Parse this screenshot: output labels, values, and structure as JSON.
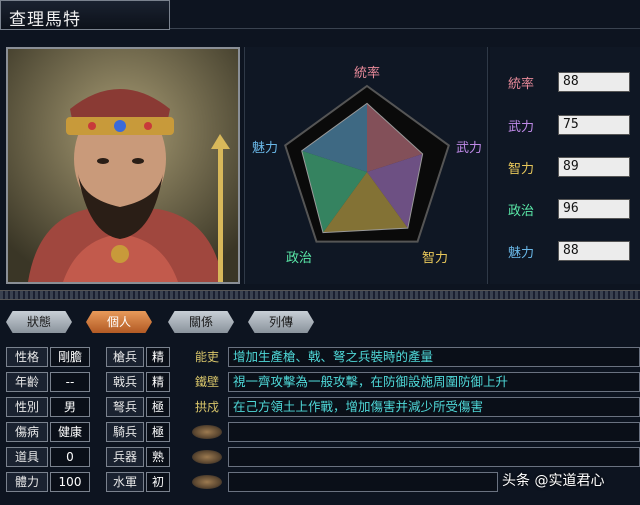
{
  "character": {
    "name": "查理馬特"
  },
  "radar": {
    "labels": [
      "統率",
      "武力",
      "智力",
      "政治",
      "魅力"
    ],
    "label_colors": [
      "#e88a9a",
      "#c08ae8",
      "#e8c85a",
      "#5ae8a8",
      "#6ab8e8"
    ],
    "values": [
      88,
      75,
      89,
      96,
      88
    ],
    "max": 100
  },
  "stats": [
    {
      "label": "統率",
      "value": "88",
      "color": "#e88a9a"
    },
    {
      "label": "武力",
      "value": "75",
      "color": "#c08ae8"
    },
    {
      "label": "智力",
      "value": "89",
      "color": "#e8c85a"
    },
    {
      "label": "政治",
      "value": "96",
      "color": "#5ae8a8"
    },
    {
      "label": "魅力",
      "value": "88",
      "color": "#6ab8e8"
    }
  ],
  "tabs": [
    "狀態",
    "個人",
    "關係",
    "列傳"
  ],
  "active_tab": "個人",
  "personal": [
    {
      "label": "性格",
      "value": "剛膽"
    },
    {
      "label": "年齡",
      "value": "--"
    },
    {
      "label": "性別",
      "value": "男"
    },
    {
      "label": "傷病",
      "value": "健康"
    },
    {
      "label": "道具",
      "value": "0"
    },
    {
      "label": "體力",
      "value": "100"
    }
  ],
  "troops": [
    {
      "label": "槍兵",
      "value": "精"
    },
    {
      "label": "戟兵",
      "value": "精"
    },
    {
      "label": "弩兵",
      "value": "極"
    },
    {
      "label": "騎兵",
      "value": "極"
    },
    {
      "label": "兵器",
      "value": "熟"
    },
    {
      "label": "水軍",
      "value": "初"
    }
  ],
  "skills": [
    {
      "name": "能吏",
      "desc": "增加生產槍、戟、弩之兵裝時的產量"
    },
    {
      "name": "鐵壁",
      "desc": "視一齊攻擊為一般攻擊，在防御設施周圍防御上升"
    },
    {
      "name": "拱戍",
      "desc": "在己方領土上作戰，增加傷害并減少所受傷害"
    },
    {
      "name": "",
      "desc": ""
    },
    {
      "name": "",
      "desc": ""
    },
    {
      "name": "",
      "desc": ""
    }
  ],
  "watermark": "头条 @实道君心"
}
